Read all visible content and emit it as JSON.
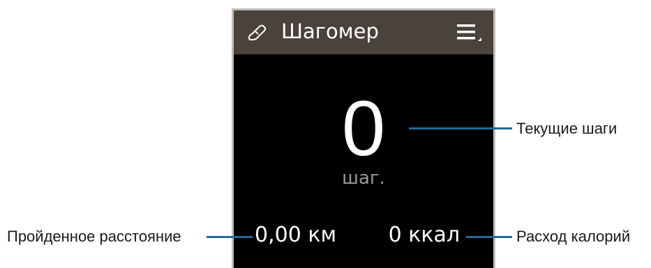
{
  "header": {
    "title": "Шагомер",
    "icon": "shoe-icon",
    "menu_icon": "menu-icon"
  },
  "steps": {
    "value": "0",
    "unit": "шаг."
  },
  "distance": {
    "value": "0,00 км"
  },
  "calories": {
    "value": "0 ккал"
  },
  "callouts": {
    "current_steps": "Текущие шаги",
    "distance": "Пройденное расстояние",
    "calories": "Расход калорий"
  },
  "colors": {
    "header_bg": "#4a423b",
    "screen_bg": "#000000",
    "callout_line": "#1f6a9a",
    "unit_text": "#9a9a9a"
  }
}
